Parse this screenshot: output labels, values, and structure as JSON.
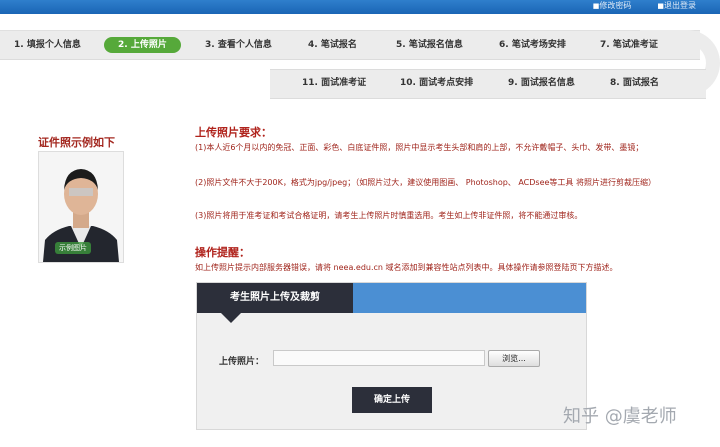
{
  "topbar": {
    "links": [
      "修改密码",
      "退出登录"
    ]
  },
  "steps_row1": [
    {
      "label": "1. 填报个人信息",
      "active": false
    },
    {
      "label": "2. 上传照片",
      "active": true
    },
    {
      "label": "3. 查看个人信息",
      "active": false
    },
    {
      "label": "4. 笔试报名",
      "active": false
    },
    {
      "label": "5. 笔试报名信息",
      "active": false
    },
    {
      "label": "6. 笔试考场安排",
      "active": false
    },
    {
      "label": "7. 笔试准考证",
      "active": false
    }
  ],
  "steps_row2": [
    {
      "label": "11. 面试准考证"
    },
    {
      "label": "10. 面试考点安排"
    },
    {
      "label": "9. 面试报名信息"
    },
    {
      "label": "8. 面试报名"
    }
  ],
  "sample": {
    "title": "证件照示例如下",
    "watermark": "示例图片"
  },
  "requirements": {
    "title": "上传照片要求：",
    "lines": [
      "(1)本人近6个月以内的免冠、正面、彩色、白底证件照，照片中显示考生头部和肩的上部，不允许戴帽子、头巾、发带、墨镜；",
      "(2)照片文件不大于200K，格式为jpg/jpeg；（如照片过大，建议使用图画、 Photoshop、 ACDsee等工具 将照片进行剪裁压缩）",
      "(3)照片将用于准考证和考试合格证明，请考生上传照片时慎重选用。考生如上传非证件照，将不能通过审核。"
    ]
  },
  "tips": {
    "title": "操作提醒：",
    "text": "如上传照片提示内部服务器错误，请将 neea.edu.cn 域名添加到兼容性站点列表中。具体操作请参照登陆页下方描述。"
  },
  "upload_panel": {
    "tab_title": "考生照片上传及裁剪",
    "field_label": "上传照片：",
    "field_value": "",
    "browse_label": "浏览...",
    "confirm_label": "确定上传"
  },
  "watermark_text": "知乎 @虞老师",
  "colors": {
    "accent_green": "#56a93a",
    "header_blue": "#4b8fd3",
    "dark_tab": "#2c2f3a",
    "text_red": "#a0261d"
  }
}
